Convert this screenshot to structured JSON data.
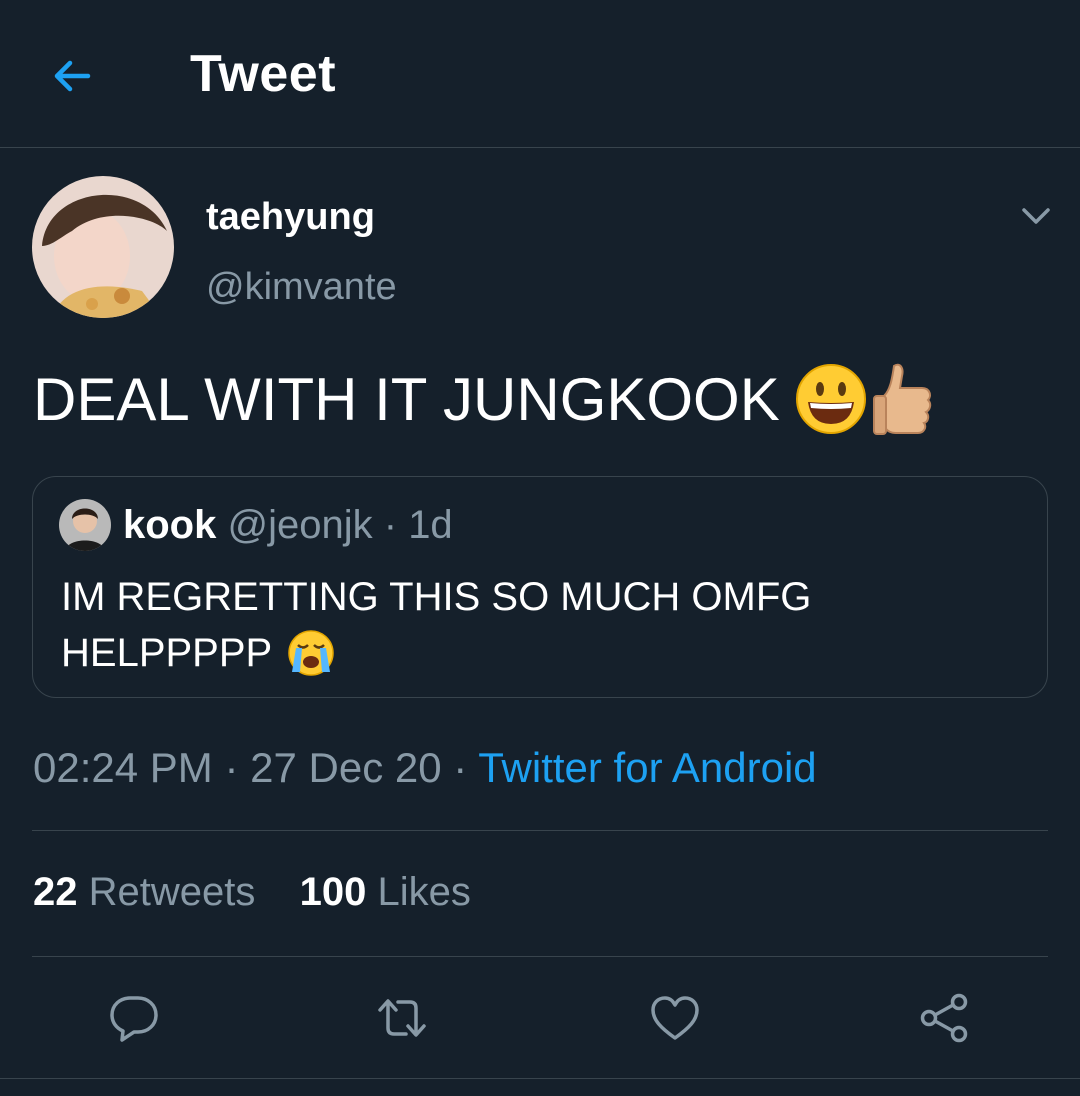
{
  "header": {
    "title": "Tweet",
    "back_icon": "arrow-left-icon",
    "accent_color": "#1da1f2"
  },
  "tweet": {
    "author": {
      "display_name": "taehyung",
      "handle": "@kimvante",
      "avatar_icon": "avatar-photo"
    },
    "text": "DEAL WITH IT JUNGKOOK",
    "emojis": [
      "grinning-face-emoji",
      "thumbs-up-emoji"
    ],
    "quoted": {
      "display_name": "kook",
      "handle": "@jeonjk",
      "separator": "·",
      "time_ago": "1d",
      "line1": "IM REGRETTING THIS SO MUCH OMFG",
      "line2": "HELPPPPP",
      "emoji": "loudly-crying-face-emoji"
    },
    "time": "02:24 PM",
    "date": "27 Dec 20",
    "separator": "·",
    "source": "Twitter for Android",
    "retweets_count": "22",
    "retweets_label": "Retweets",
    "likes_count": "100",
    "likes_label": "Likes"
  },
  "actions": [
    "reply-icon",
    "retweet-icon",
    "like-icon",
    "share-icon"
  ],
  "colors": {
    "background": "#15202b",
    "divider": "#38444d",
    "secondary_text": "#8899a6",
    "link": "#1da1f2"
  }
}
